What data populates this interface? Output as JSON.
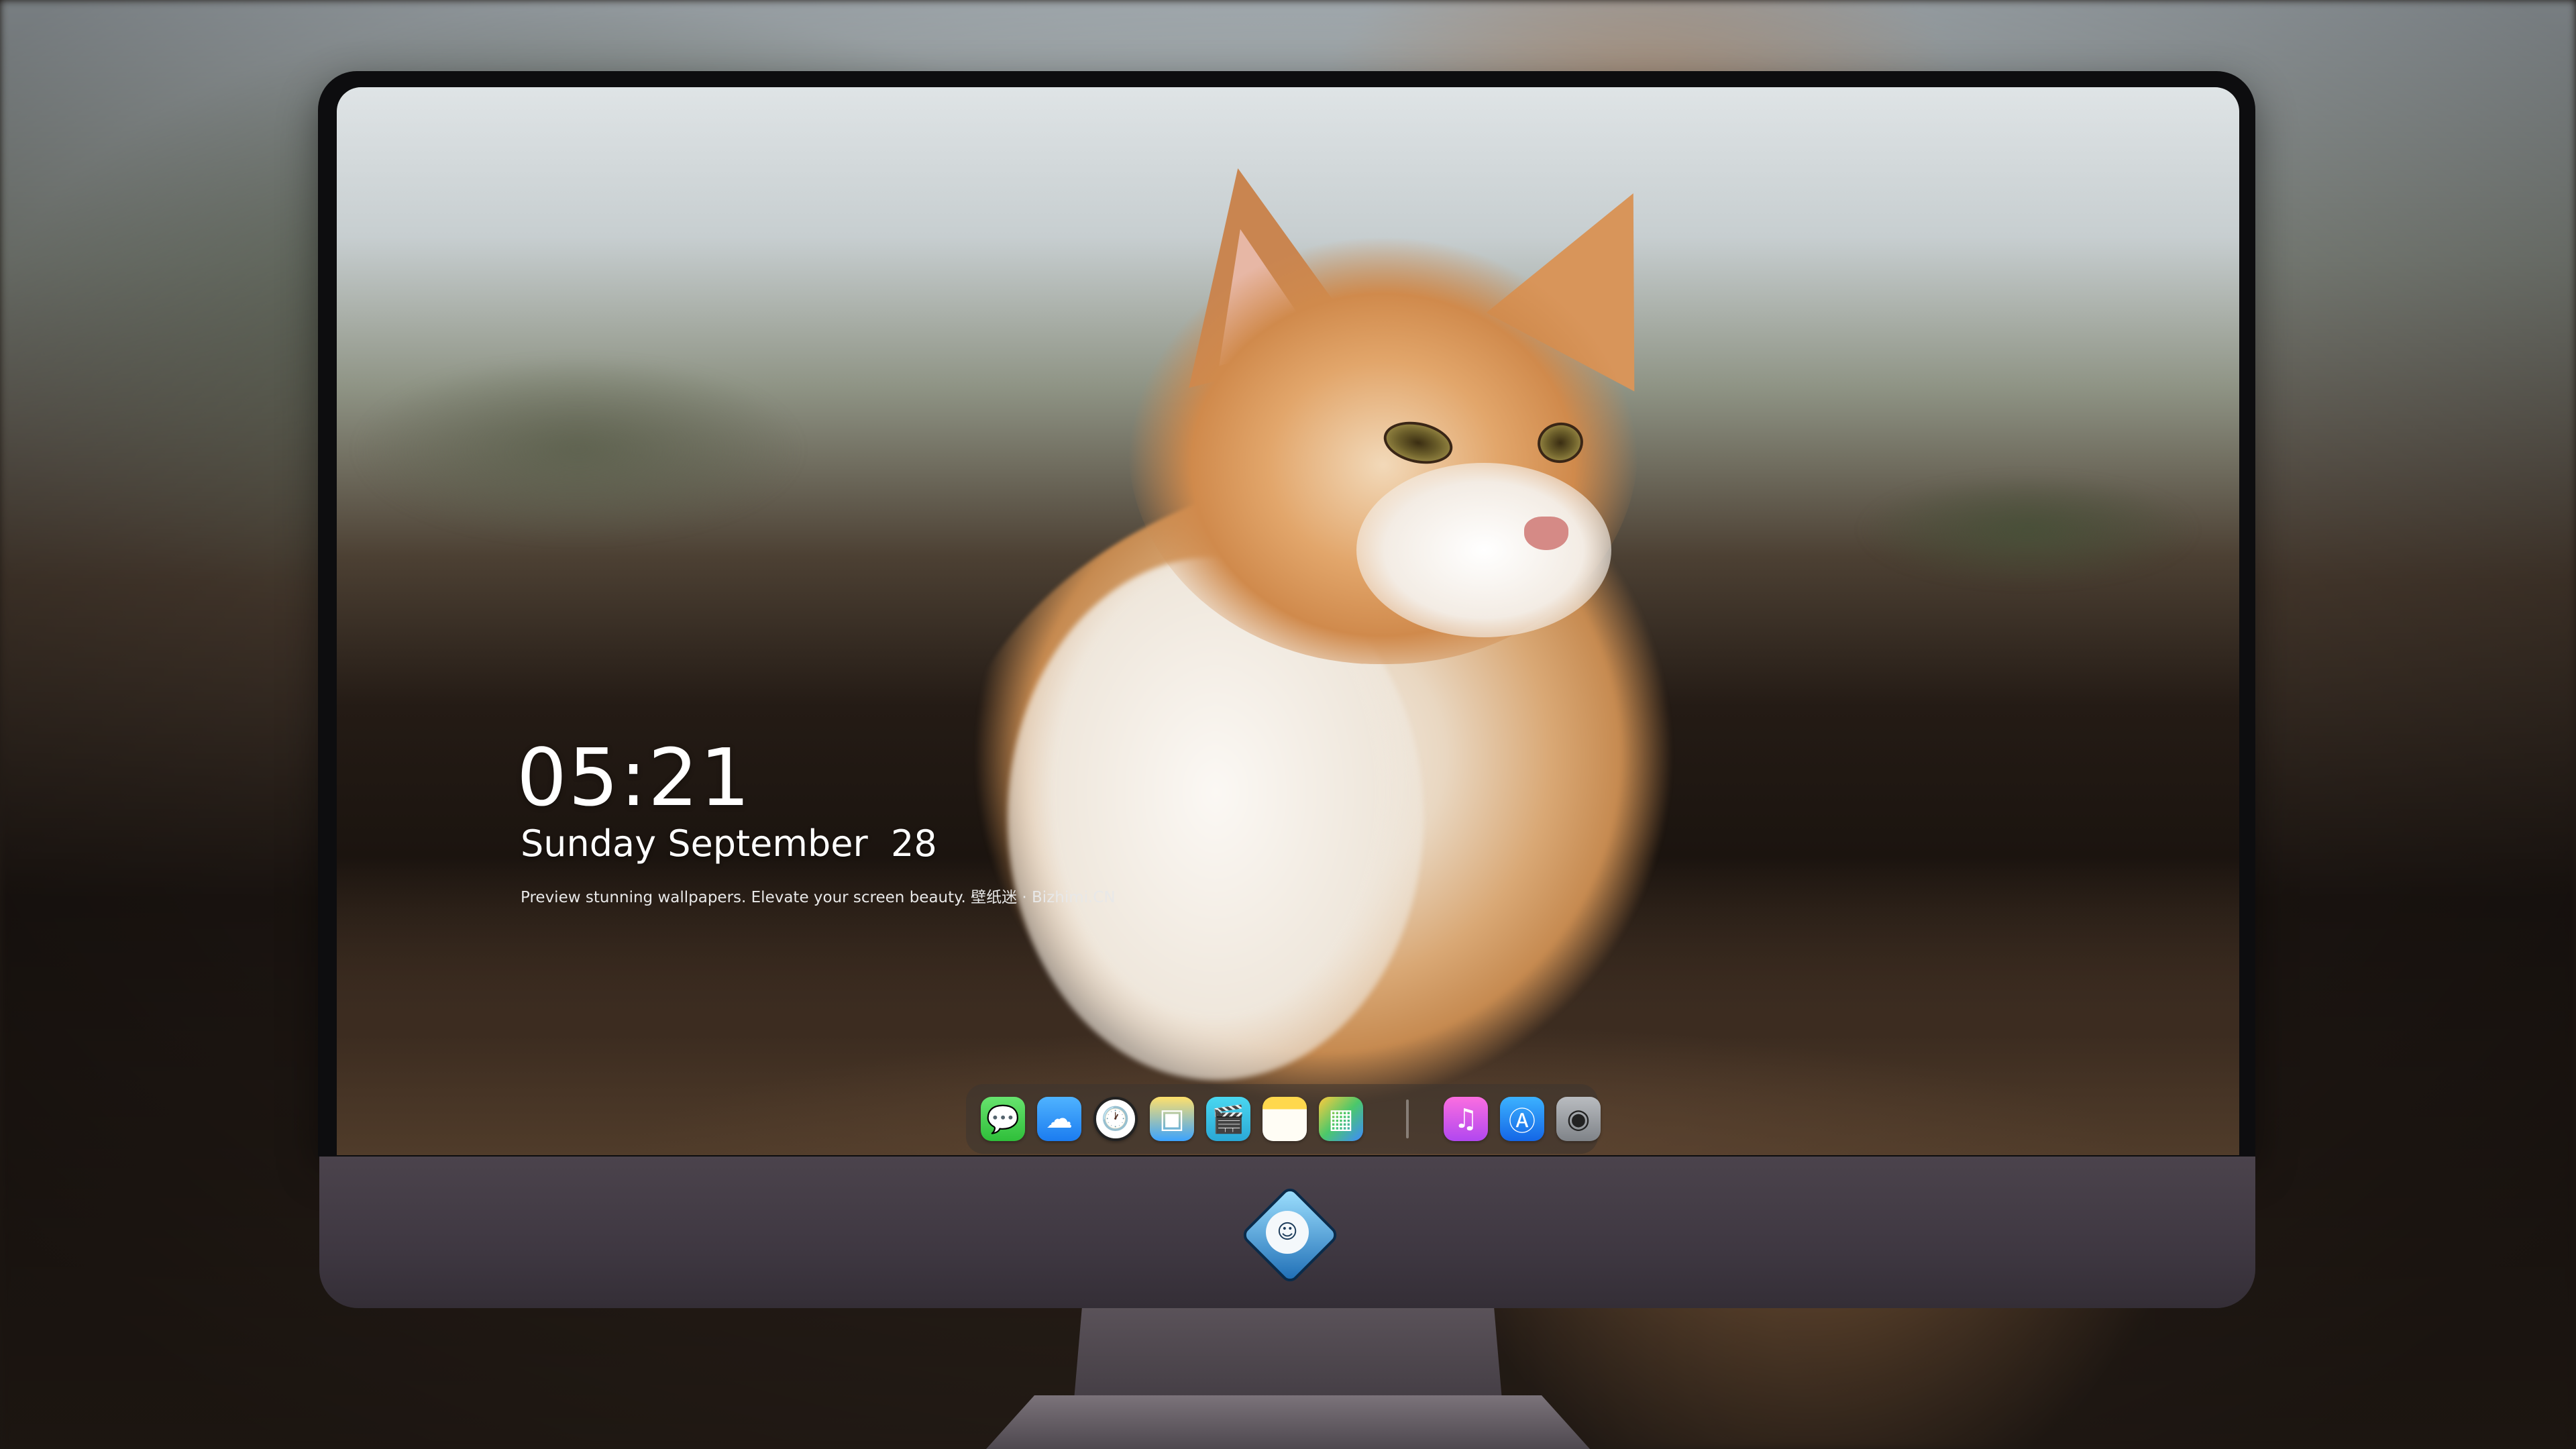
{
  "lock_screen": {
    "time": "05:21",
    "date": "Sunday September  28",
    "tagline": "Preview stunning wallpapers. Elevate your screen beauty. 壁纸迷 · Bizhimi.CN"
  },
  "dock": {
    "apps": [
      {
        "name": "Messages",
        "icon": "messages-icon",
        "glyph": "💬"
      },
      {
        "name": "Weather",
        "icon": "weather-icon",
        "glyph": "☁"
      },
      {
        "name": "Clock",
        "icon": "clock-icon",
        "glyph": "🕐"
      },
      {
        "name": "Finder",
        "icon": "finder-icon",
        "glyph": "▣"
      },
      {
        "name": "Videos",
        "icon": "clapperboard-icon",
        "glyph": "🎬"
      },
      {
        "name": "Notes",
        "icon": "notes-icon",
        "glyph": ""
      },
      {
        "name": "Photos",
        "icon": "photos-icon",
        "glyph": "▦"
      },
      {
        "name": "Music",
        "icon": "music-icon",
        "glyph": "♫"
      },
      {
        "name": "App Store",
        "icon": "app-store-icon",
        "glyph": "Ⓐ"
      },
      {
        "name": "Camera",
        "icon": "camera-icon",
        "glyph": "◉"
      }
    ]
  },
  "colors": {
    "text": "#ffffff",
    "monitor_chin": "#4b434c",
    "bezel": "#0d0d0f"
  }
}
